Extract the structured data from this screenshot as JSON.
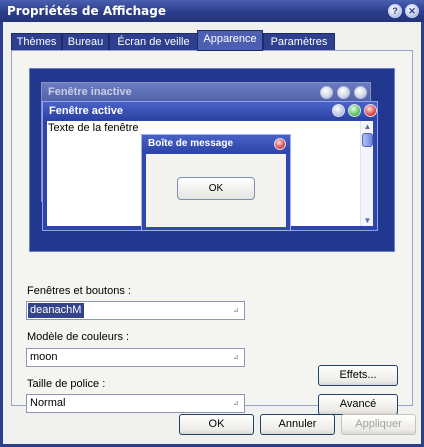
{
  "window": {
    "title": "Propriétés de Affichage",
    "help_glyph": "?",
    "close_glyph": "✕"
  },
  "tabs": [
    {
      "label": "Thèmes"
    },
    {
      "label": "Bureau"
    },
    {
      "label": "Écran de veille"
    },
    {
      "label": "Apparence",
      "active": true
    },
    {
      "label": "Paramètres"
    }
  ],
  "preview": {
    "inactive_title": "Fenêtre inactive",
    "active_title": "Fenêtre active",
    "window_text": "Texte de la fenêtre",
    "message_title": "Boîte de message",
    "message_ok": "OK",
    "scroll_up": "▲",
    "scroll_down": "▼"
  },
  "fields": {
    "windows_buttons_label": "Fenêtres et boutons :",
    "windows_buttons_value": "deanachM",
    "color_scheme_label": "Modèle de couleurs :",
    "color_scheme_value": "moon",
    "font_size_label": "Taille de police :",
    "font_size_value": "Normal",
    "dropdown_glyph": "⊿"
  },
  "buttons": {
    "effects": "Effets...",
    "advanced": "Avancé",
    "ok": "OK",
    "cancel": "Annuler",
    "apply": "Appliquer"
  },
  "colors": {
    "title_bar": "#2b3d8a",
    "preview_background": "#22378e",
    "selection": "#34438a"
  }
}
